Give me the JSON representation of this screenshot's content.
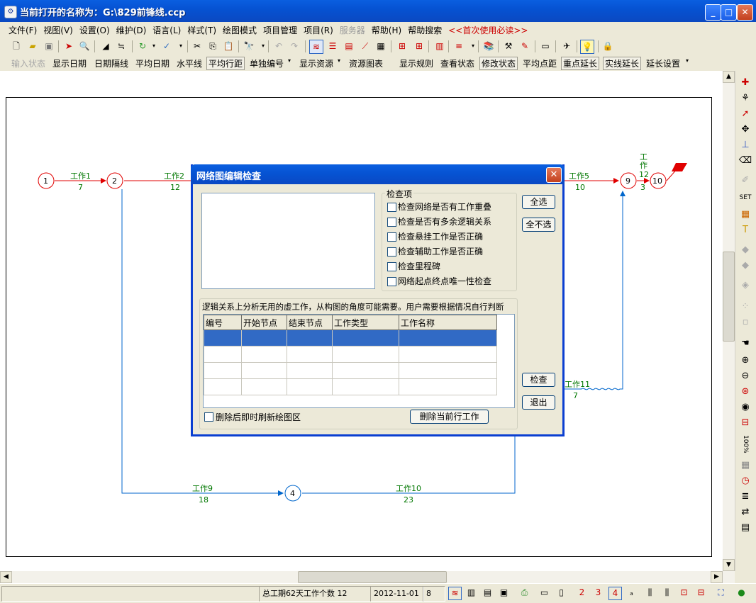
{
  "window": {
    "title": "当前打开的名称为：G:\\829前锋线.ccp",
    "minimize": "_",
    "maximize": "□",
    "close": "✕"
  },
  "menubar": {
    "items": [
      "文件(F)",
      "视图(V)",
      "设置(O)",
      "维护(D)",
      "语言(L)",
      "样式(T)",
      "绘图模式",
      "项目管理",
      "项目(R)",
      "服务器",
      "帮助(H)",
      "帮助搜索",
      "<<首次使用必读>>"
    ]
  },
  "modebar": {
    "items": [
      "输入状态",
      "显示日期",
      "日期隔线",
      "平均日期",
      "水平线",
      "平均行距",
      "单独编号",
      "显示资源",
      "资源图表",
      "显示规则",
      "查看状态",
      "修改状态",
      "平均点距",
      "重点延长",
      "实线延长",
      "延长设置"
    ]
  },
  "network": {
    "nodes": [
      "1",
      "2",
      "4",
      "9",
      "10"
    ],
    "works": [
      {
        "name": "工作1",
        "days": "7"
      },
      {
        "name": "工作2",
        "days": "12"
      },
      {
        "name": "工作5",
        "days": "10"
      },
      {
        "name": "工作9",
        "days": "18"
      },
      {
        "name": "工作10",
        "days": "23"
      },
      {
        "name": "工作11",
        "days": "7"
      },
      {
        "name": "工作",
        "days": "3",
        "extra": "12"
      }
    ]
  },
  "dialog": {
    "title": "网络图编辑检查",
    "check_group": "检查项",
    "checks": [
      "检查网络是否有工作重叠",
      "检查是否有多余逻辑关系",
      "检查悬挂工作是否正确",
      "检查辅助工作是否正确",
      "检查里程碑",
      "网络起点终点唯一性检查"
    ],
    "select_all": "全选",
    "select_none": "全不选",
    "info": "逻辑关系上分析无用的虚工作，从构图的角度可能需要。用户需要根据情况自行判断",
    "columns": [
      "编号",
      "开始节点",
      "结束节点",
      "工作类型",
      "工作名称"
    ],
    "check_button": "检查",
    "exit_button": "退出",
    "refresh_label": "删除后即时刷新绘图区",
    "delete_button": "删除当前行工作"
  },
  "statusbar": {
    "summary": "总工期62天工作个数 12",
    "date": "2012-11-01",
    "num": "8"
  },
  "palette": {
    "zoom": "100%"
  },
  "colors": {
    "red_path": "#e00000",
    "blue_path": "#0066cc",
    "label_green": "#007700"
  }
}
